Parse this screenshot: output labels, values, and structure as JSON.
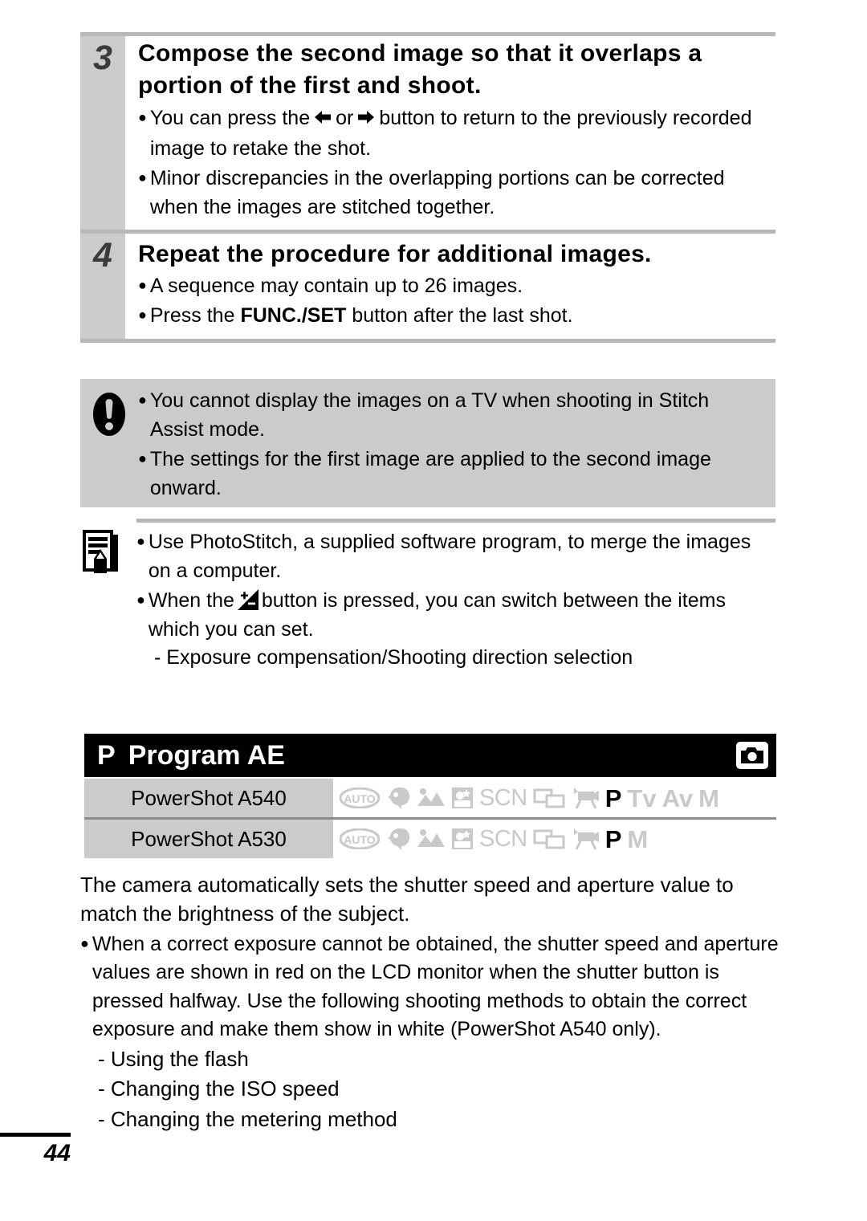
{
  "steps": [
    {
      "number": "3",
      "title": "Compose the second image so that it overlaps a portion of the first and shoot.",
      "bullets": [
        {
          "pre": "You can press the",
          "icons": [
            "left-arrow",
            "right-arrow"
          ],
          "mid": "or",
          "post": "button to return to the previously recorded image to retake the shot."
        },
        {
          "text": "Minor discrepancies in the overlapping portions can be corrected when the images are stitched together."
        }
      ]
    },
    {
      "number": "4",
      "title": "Repeat the procedure for additional images.",
      "bullets": [
        {
          "text": "A sequence may contain up to 26 images."
        },
        {
          "pre": "Press the",
          "bold": "FUNC./SET",
          "post": "button after the last shot."
        }
      ]
    }
  ],
  "warning": {
    "icon": "exclamation-icon",
    "bullets": [
      "You cannot display the images on a TV when shooting in Stitch Assist mode.",
      "The settings for the first image are applied to the second image onward."
    ]
  },
  "note": {
    "icon": "memo-icon",
    "bullets": [
      {
        "text": "Use PhotoStitch, a supplied software program, to merge the images on a computer."
      },
      {
        "pre": "When the",
        "inline_icon": "exposure-compensation-icon",
        "post": "button is pressed, you can switch between the items which you can set."
      }
    ],
    "sub_items": [
      "- Exposure compensation/Shooting direction selection"
    ]
  },
  "section": {
    "mode_letter": "P",
    "title": "Program AE",
    "badge_icon": "camera-icon",
    "header_bg": "#000000",
    "header_fg": "#ffffff"
  },
  "mode_table": {
    "rows": [
      {
        "camera": "PowerShot A540",
        "modes": [
          {
            "name": "auto-mode-icon",
            "label": "AUTO",
            "type": "icon",
            "active": false
          },
          {
            "name": "portrait-mode-icon",
            "label": "Portrait",
            "type": "icon",
            "active": false
          },
          {
            "name": "landscape-mode-icon",
            "label": "Landscape",
            "type": "icon",
            "active": false
          },
          {
            "name": "night-snapshot-mode-icon",
            "label": "Night Snapshot",
            "type": "icon",
            "active": false
          },
          {
            "name": "scn-mode-label",
            "label": "SCN",
            "type": "text",
            "active": false
          },
          {
            "name": "stitch-assist-mode-icon",
            "label": "Stitch Assist",
            "type": "icon",
            "active": false
          },
          {
            "name": "movie-mode-icon",
            "label": "Movie",
            "type": "icon",
            "active": false
          },
          {
            "name": "program-mode-label",
            "label": "P",
            "type": "letter",
            "active": true
          },
          {
            "name": "tv-mode-label",
            "label": "Tv",
            "type": "letter",
            "active": false
          },
          {
            "name": "av-mode-label",
            "label": "Av",
            "type": "letter",
            "active": false
          },
          {
            "name": "manual-mode-label",
            "label": "M",
            "type": "letter",
            "active": false
          }
        ]
      },
      {
        "camera": "PowerShot A530",
        "modes": [
          {
            "name": "auto-mode-icon",
            "label": "AUTO",
            "type": "icon",
            "active": false
          },
          {
            "name": "portrait-mode-icon",
            "label": "Portrait",
            "type": "icon",
            "active": false
          },
          {
            "name": "landscape-mode-icon",
            "label": "Landscape",
            "type": "icon",
            "active": false
          },
          {
            "name": "night-snapshot-mode-icon",
            "label": "Night Snapshot",
            "type": "icon",
            "active": false
          },
          {
            "name": "scn-mode-label",
            "label": "SCN",
            "type": "text",
            "active": false
          },
          {
            "name": "stitch-assist-mode-icon",
            "label": "Stitch Assist",
            "type": "icon",
            "active": false
          },
          {
            "name": "movie-mode-icon",
            "label": "Movie",
            "type": "icon",
            "active": false
          },
          {
            "name": "program-mode-label",
            "label": "P",
            "type": "letter",
            "active": true
          },
          {
            "name": "manual-mode-label",
            "label": "M",
            "type": "letter",
            "active": false
          }
        ]
      }
    ]
  },
  "body": {
    "intro": "The camera automatically sets the shutter speed and aperture value to match the brightness of the subject.",
    "bullet": "When a correct exposure cannot be obtained, the shutter speed and aperture values are shown in red on the LCD monitor when the shutter button is pressed halfway. Use the following shooting methods to obtain the correct exposure and make them show in white (PowerShot A540 only).",
    "sub_items": [
      "- Using the flash",
      "- Changing the ISO speed",
      "- Changing the metering method"
    ]
  },
  "page_number": "44"
}
